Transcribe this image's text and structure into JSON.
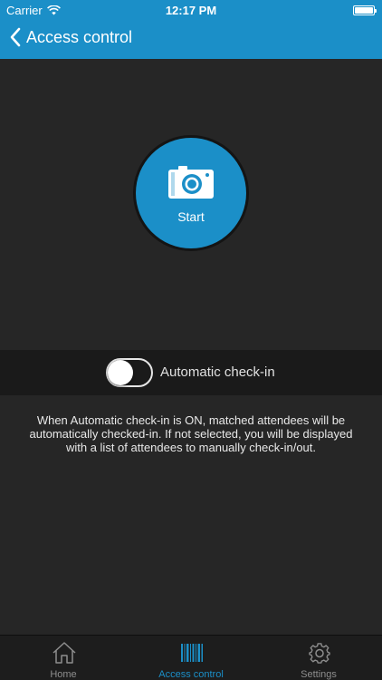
{
  "status_bar": {
    "carrier": "Carrier",
    "time": "12:17 PM"
  },
  "nav": {
    "title": "Access control"
  },
  "start": {
    "label": "Start"
  },
  "toggle": {
    "label": "Automatic check-in",
    "on": false
  },
  "info": {
    "text": "When Automatic check-in is ON, matched attendees will be automatically checked-in. If not selected, you will be displayed with a list of attendees to manually check-in/out."
  },
  "tabs": [
    {
      "label": "Home",
      "icon": "home-icon"
    },
    {
      "label": "Access control",
      "icon": "barcode-icon"
    },
    {
      "label": "Settings",
      "icon": "gear-icon"
    }
  ],
  "colors": {
    "accent": "#1b8fc8",
    "background": "#262626",
    "panel": "#1a1a1a"
  }
}
